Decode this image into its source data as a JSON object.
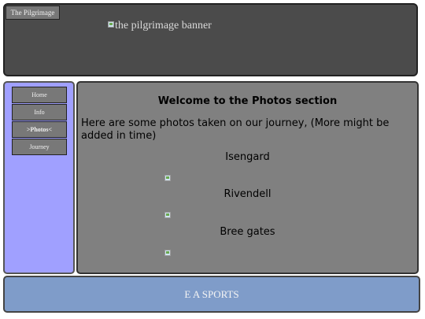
{
  "header": {
    "site_tab": "The Pilgrimage",
    "banner_alt": "the pilgrimage banner"
  },
  "sidebar": {
    "items": [
      {
        "label": "Home"
      },
      {
        "label": "Info"
      },
      {
        "label": ">Photos<"
      },
      {
        "label": "Journey"
      }
    ]
  },
  "main": {
    "heading": "Welcome to the Photos section",
    "intro": "Here are some photos taken on our journey, (More might be added in time)",
    "photos": [
      {
        "title": "Isengard"
      },
      {
        "title": "Rivendell"
      },
      {
        "title": "Bree gates"
      }
    ]
  },
  "footer": {
    "text": "E A SPORTS"
  },
  "colors": {
    "header_bg": "#4b4b4b",
    "sidebar_bg": "#a0a0ff",
    "main_bg": "#808080",
    "footer_bg": "#7f9cc9"
  }
}
